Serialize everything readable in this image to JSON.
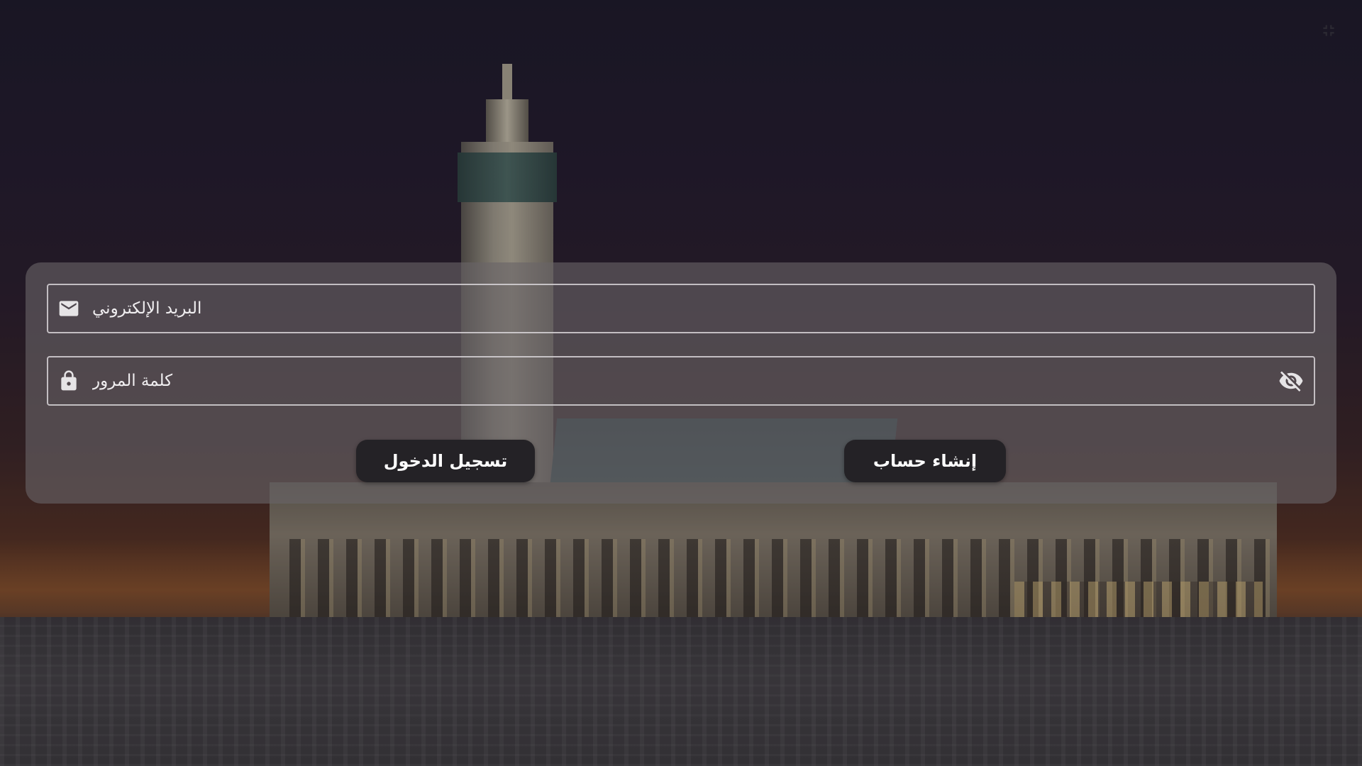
{
  "form": {
    "email": {
      "placeholder": "البريد الإلكتروني",
      "value": "",
      "icon": "email-icon"
    },
    "password": {
      "placeholder": "كلمة المرور",
      "value": "",
      "icon": "lock-icon",
      "toggle_icon": "visibility-off-icon"
    },
    "buttons": {
      "login_label": "تسجيل الدخول",
      "register_label": "إنشاء حساب"
    }
  },
  "toolbar": {
    "exit_fullscreen_icon": "fullscreen-exit-icon"
  },
  "colors": {
    "button_bg": "#242226",
    "card_bg": "#69646a",
    "field_border": "#d7d4d7",
    "text": "#f1eff1"
  }
}
